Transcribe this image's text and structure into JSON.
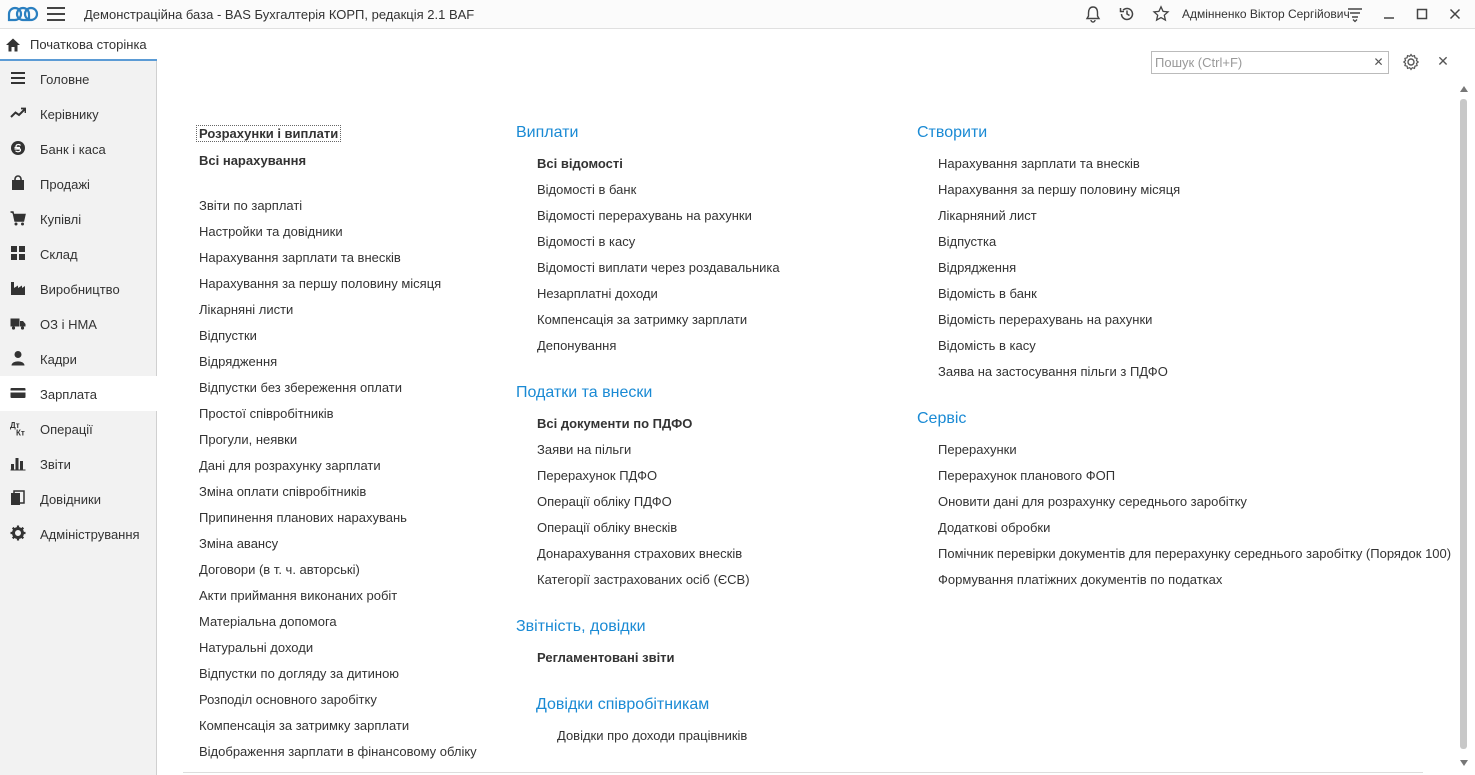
{
  "titlebar": {
    "title": "Демонстраційна база - BAS Бухгалтерія КОРП, редакція 2.1 BAF",
    "user": "Адмiнненко Віктор Сергійович"
  },
  "sidebar": {
    "home": "Початкова сторінка",
    "items": [
      {
        "label": "Головне",
        "icon": "list-icon"
      },
      {
        "label": "Керівнику",
        "icon": "trend-icon"
      },
      {
        "label": "Банк і каса",
        "icon": "coin-icon"
      },
      {
        "label": "Продажі",
        "icon": "bag-icon"
      },
      {
        "label": "Купівлі",
        "icon": "cart-icon"
      },
      {
        "label": "Склад",
        "icon": "grid-icon"
      },
      {
        "label": "Виробництво",
        "icon": "factory-icon"
      },
      {
        "label": "ОЗ і НМА",
        "icon": "truck-icon"
      },
      {
        "label": "Кадри",
        "icon": "person-icon"
      },
      {
        "label": "Зарплата",
        "icon": "wallet-icon"
      },
      {
        "label": "Операції",
        "icon": "dt-kt-icon"
      },
      {
        "label": "Звіти",
        "icon": "bar-chart-icon"
      },
      {
        "label": "Довідники",
        "icon": "books-icon"
      },
      {
        "label": "Адміністрування",
        "icon": "gear-icon"
      }
    ],
    "active_index": 9
  },
  "search": {
    "placeholder": "Пошук (Ctrl+F)",
    "value": ""
  },
  "colors": {
    "accent": "#1a8ad4",
    "active_underline": "#5b9bd5"
  },
  "left_column": {
    "top_links": [
      {
        "label": "Розрахунки і виплати",
        "bold": true
      },
      {
        "label": "Всі нарахування",
        "bold": true
      }
    ],
    "links": [
      "Звіти по зарплаті",
      "Настройки та довідники",
      "Нарахування зарплати та внесків",
      "Нарахування за першу половину місяця",
      "Лікарняні листи",
      "Відпустки",
      "Відрядження",
      "Відпустки без збереження оплати",
      "Простої співробітників",
      "Прогули, неявки",
      "Дані для розрахунку зарплати",
      "Зміна оплати співробітників",
      "Припинення планових нарахувань",
      "Зміна авансу",
      "Договори (в т. ч. авторські)",
      "Акти приймання виконаних робіт",
      "Матеріальна допомога",
      "Натуральні доходи",
      "Відпустки по догляду за дитиною",
      "Розподіл основного заробітку",
      "Компенсація за затримку зарплати",
      "Відображення зарплати в фінансовому обліку"
    ]
  },
  "middle_column": {
    "payments": {
      "title": "Виплати",
      "bold_link": "Всі відомості",
      "links": [
        "Відомості в банк",
        "Відомості перерахувань на рахунки",
        "Відомості в касу",
        "Відомості виплати через роздавальника",
        "Незарплатні доходи",
        "Компенсація за затримку зарплати",
        "Депонування"
      ]
    },
    "taxes": {
      "title": "Податки та внески",
      "bold_link": "Всі документи по ПДФО",
      "links": [
        "Заяви на пільги",
        "Перерахунок ПДФО",
        "Операції обліку ПДФО",
        "Операції обліку внесків",
        "Донарахування страхових внесків",
        "Категорії застрахованих осіб (ЄСВ)"
      ]
    },
    "reports": {
      "title": "Звітність, довідки",
      "bold_link": "Регламентовані звіти"
    },
    "certs": {
      "title": "Довідки співробітникам",
      "links": [
        "Довідки про доходи працівників"
      ]
    }
  },
  "right_column": {
    "create": {
      "title": "Створити",
      "links": [
        "Нарахування зарплати та внесків",
        "Нарахування за першу половину місяця",
        "Лікарняний лист",
        "Відпустка",
        "Відрядження",
        "Відомість в банк",
        "Відомість перерахувань на рахунки",
        "Відомість в касу",
        "Заява на застосування пільги з ПДФО"
      ]
    },
    "service": {
      "title": "Сервіс",
      "links": [
        "Перерахунки",
        "Перерахунок планового ФОП",
        "Оновити дані для розрахунку середнього заробітку",
        "Додаткові обробки",
        "Помічник перевірки документів для перерахунку середнього заробітку (Порядок 100)",
        "Формування платіжних документів по податках"
      ]
    }
  }
}
